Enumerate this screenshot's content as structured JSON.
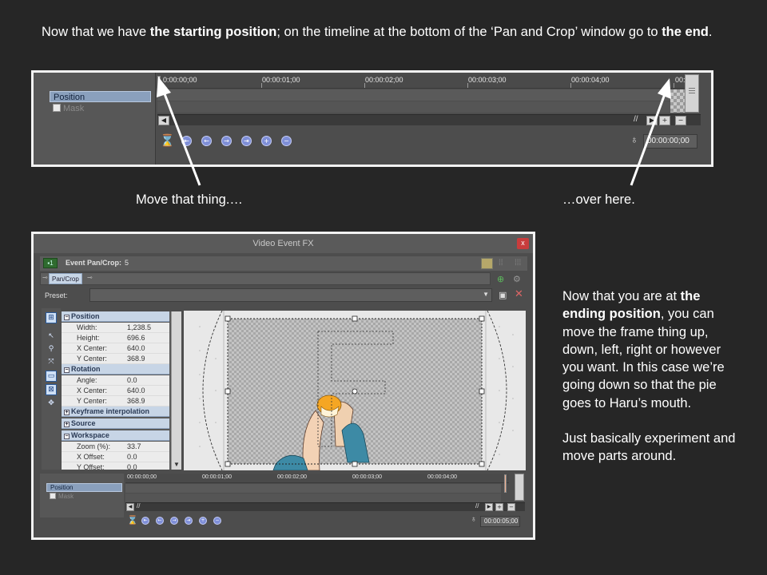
{
  "slide": {
    "intro": {
      "part1": "Now that we have ",
      "bold1": "the starting position",
      "part2": "; on the timeline at the bottom of the ‘Pan and Crop’ window go to ",
      "bold2": "the end",
      "part3": "."
    },
    "callout_left": "Move that thing.…",
    "callout_right": "…over here.",
    "side_text": {
      "part1": "Now that you are at ",
      "bold1": "the ending position",
      "part2": ", you can move the frame thing up, down, left, right or however you want. In this case we’re going down so that the pie goes to Haru’s mouth.",
      "para2": "Just basically experiment and move parts around."
    }
  },
  "top_timeline": {
    "tracks": [
      {
        "label": "Position",
        "selected": true
      },
      {
        "label": "Mask",
        "selected": false
      }
    ],
    "ruler_ticks": [
      "0:00:00;00",
      "00:00:01;00",
      "00:00:02;00",
      "00:00:03;00",
      "00:00:04;00",
      "00:"
    ],
    "time_value": "00:00:00;00",
    "scroll_glyph": "//"
  },
  "fx_window": {
    "title": "Video Event FX",
    "close": "x",
    "event_label": "Event Pan/Crop:",
    "event_number": "5",
    "plugin_chip": "Pan/Crop",
    "preset_label": "Preset:",
    "properties": {
      "position": {
        "header": "Position",
        "rows": [
          {
            "key": "Width:",
            "value": "1,238.5"
          },
          {
            "key": "Height:",
            "value": "696.6"
          },
          {
            "key": "X Center:",
            "value": "640.0"
          },
          {
            "key": "Y Center:",
            "value": "368.9"
          }
        ]
      },
      "rotation": {
        "header": "Rotation",
        "rows": [
          {
            "key": "Angle:",
            "value": "0.0"
          },
          {
            "key": "X Center:",
            "value": "640.0"
          },
          {
            "key": "Y Center:",
            "value": "368.9"
          }
        ]
      },
      "keyframe_header": "Keyframe interpolation",
      "source_header": "Source",
      "workspace": {
        "header": "Workspace",
        "rows": [
          {
            "key": "Zoom (%):",
            "value": "33.7"
          },
          {
            "key": "X Offset:",
            "value": "0.0"
          },
          {
            "key": "Y Offset:",
            "value": "0.0"
          }
        ]
      }
    },
    "canvas": {
      "frame_letter": "F"
    },
    "timeline": {
      "tracks": [
        {
          "label": "Position",
          "selected": true
        },
        {
          "label": "Mask",
          "selected": false
        }
      ],
      "ruler_ticks": [
        "00:00:00;00",
        "00:00:01;00",
        "00:00:02;00",
        "00:00:03;00",
        "00:00:04;00"
      ],
      "time_value": "00:00:05;00",
      "scroll_glyph": "//"
    }
  },
  "colors": {
    "background": "#262626",
    "panel": "#4d4d4d",
    "selected_track": "#8aa0bd",
    "keyframe_button": "#7f8fd8",
    "close_button": "#c83c3c",
    "property_header": "#c7d5e6"
  },
  "icons": [
    "arrow-up-left",
    "arrow-up-right",
    "keyframe-first",
    "keyframe-prev",
    "keyframe-next",
    "keyframe-last",
    "keyframe-add",
    "keyframe-remove",
    "sync-cursor",
    "close-x",
    "pin-icon",
    "move-tool",
    "zoom-tool",
    "normal-edit-tool"
  ]
}
